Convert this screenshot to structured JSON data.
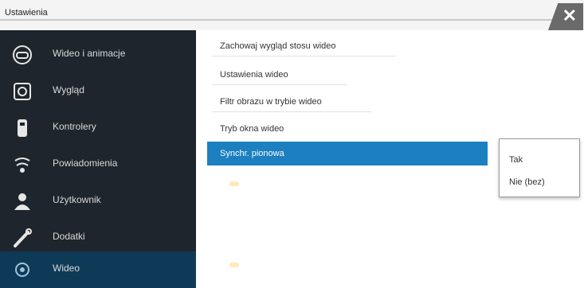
{
  "window": {
    "title": "Ustawienia",
    "close_glyph": "✕"
  },
  "sidebar": {
    "items": [
      {
        "label": "Wideo i animacje",
        "icon": "gamepad-icon"
      },
      {
        "label": "Wygląd",
        "icon": "gallery-icon"
      },
      {
        "label": "Kontrolery",
        "icon": "controller-icon"
      },
      {
        "label": "Powiadomienia",
        "icon": "lightbulb-icon"
      },
      {
        "label": "Użytkownik",
        "icon": "user-icon"
      },
      {
        "label": "Dodatki",
        "icon": "wrench-icon"
      },
      {
        "label": "Wideo",
        "icon": "settings-icon",
        "active": true
      }
    ]
  },
  "main": {
    "rows": [
      {
        "label": "Zachowaj wygląd stosu wideo"
      },
      {
        "label": "Ustawienia wideo"
      },
      {
        "label": "Filtr obrazu w trybie wideo"
      },
      {
        "label": "Tryb okna wideo"
      }
    ],
    "selected_row": {
      "label": "Synchr. pionowa"
    },
    "dropdown": {
      "options": [
        "Tak",
        "Nie (bez)"
      ]
    }
  },
  "colors": {
    "sidebar_bg": "#1e252c",
    "active_item": "#0f3a57",
    "selected_row": "#1b7fc0"
  }
}
